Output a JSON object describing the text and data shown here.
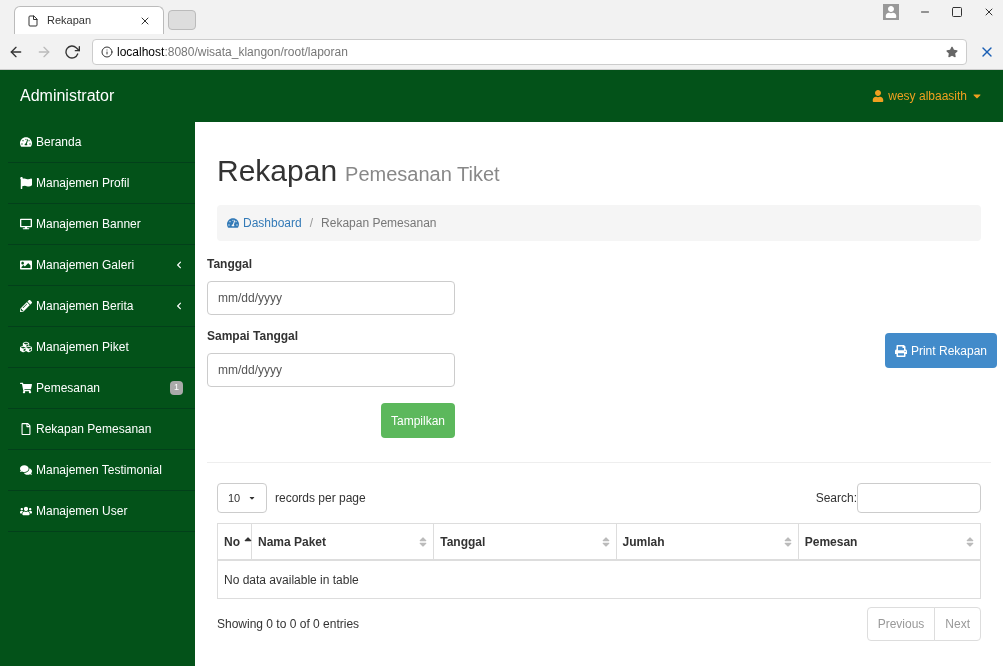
{
  "browser": {
    "tab_title": "Rekapan",
    "url_host": "localhost",
    "url_rest": ":8080/wisata_klangon/root/laporan"
  },
  "header": {
    "brand": "Administrator",
    "user": "wesy albaasith"
  },
  "sidebar": {
    "items": [
      {
        "label": "Beranda",
        "submenu": false
      },
      {
        "label": "Manajemen Profil",
        "submenu": false
      },
      {
        "label": "Manajemen Banner",
        "submenu": false
      },
      {
        "label": "Manajemen Galeri",
        "submenu": true
      },
      {
        "label": "Manajemen Berita",
        "submenu": true
      },
      {
        "label": "Manajemen Piket",
        "submenu": false
      },
      {
        "label": "Pemesanan",
        "submenu": false,
        "badge": "1"
      },
      {
        "label": "Rekapan Pemesanan",
        "submenu": false
      },
      {
        "label": "Manajemen Testimonial",
        "submenu": false
      },
      {
        "label": "Manajemen User",
        "submenu": false
      }
    ]
  },
  "page": {
    "title": "Rekapan",
    "subtitle": "Pemesanan Tiket",
    "breadcrumb_separator": "/",
    "breadcrumb": [
      {
        "label": "Dashboard",
        "link": true
      },
      {
        "label": "Rekapan Pemesanan",
        "link": false
      }
    ]
  },
  "form": {
    "fields": [
      {
        "label": "Tanggal",
        "placeholder": "mm/dd/yyyy"
      },
      {
        "label": "Sampai Tanggal",
        "placeholder": "mm/dd/yyyy"
      }
    ],
    "submit": "Tampilkan",
    "print": "Print Rekapan"
  },
  "table": {
    "page_size": "10",
    "page_size_label": "records per page",
    "search_label": "Search:",
    "columns": [
      {
        "label": "No",
        "sorted": true
      },
      {
        "label": "Nama Paket",
        "sorted": false
      },
      {
        "label": "Tanggal",
        "sorted": false
      },
      {
        "label": "Jumlah",
        "sorted": false
      },
      {
        "label": "Pemesan",
        "sorted": false
      }
    ],
    "empty": "No data available in table",
    "info": "Showing 0 to 0 of 0 entries",
    "pager": [
      {
        "label": "Previous",
        "disabled": true
      },
      {
        "label": "Next",
        "disabled": true
      }
    ]
  }
}
